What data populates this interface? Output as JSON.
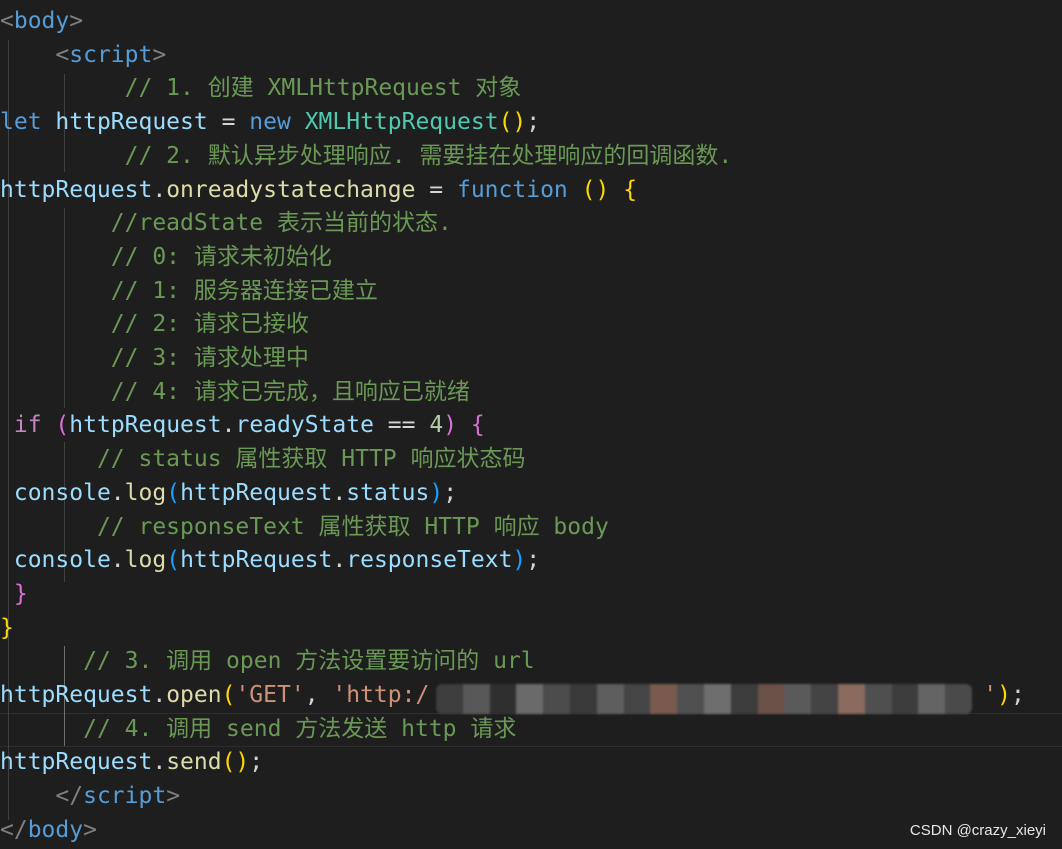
{
  "editor": {
    "theme": "dark",
    "background": "#1e1e1e",
    "lines": [
      [
        [
          "t-punct",
          "<"
        ],
        [
          "t-tag",
          "body"
        ],
        [
          "t-punct",
          ">"
        ]
      ],
      [
        [
          "t-op",
          "    "
        ],
        [
          "t-punct",
          "<"
        ],
        [
          "t-tag",
          "script"
        ],
        [
          "t-punct",
          ">"
        ]
      ],
      [
        [
          "t-op",
          "         "
        ],
        [
          "t-cm",
          "// 1. 创建 XMLHttpRequest 对象"
        ]
      ],
      [
        [
          "t-kw",
          "let"
        ],
        [
          "t-op",
          " "
        ],
        [
          "t-var",
          "httpRequest"
        ],
        [
          "t-op",
          " = "
        ],
        [
          "t-kw",
          "new"
        ],
        [
          "t-op",
          " "
        ],
        [
          "t-cls",
          "XMLHttpRequest"
        ],
        [
          "b1",
          "()"
        ],
        [
          "t-op",
          ";"
        ]
      ],
      [
        [
          "t-op",
          "         "
        ],
        [
          "t-cm",
          "// 2. 默认异步处理响应. 需要挂在处理响应的回调函数."
        ]
      ],
      [
        [
          "t-var",
          "httpRequest"
        ],
        [
          "t-op",
          "."
        ],
        [
          "t-fn",
          "onreadystatechange"
        ],
        [
          "t-op",
          " = "
        ],
        [
          "t-kw",
          "function"
        ],
        [
          "t-op",
          " "
        ],
        [
          "b1",
          "()"
        ],
        [
          "t-op",
          " "
        ],
        [
          "b1",
          "{"
        ]
      ],
      [
        [
          "t-op",
          "        "
        ],
        [
          "t-cm",
          "//readState 表示当前的状态."
        ]
      ],
      [
        [
          "t-op",
          "        "
        ],
        [
          "t-cm",
          "// 0: 请求未初始化"
        ]
      ],
      [
        [
          "t-op",
          "        "
        ],
        [
          "t-cm",
          "// 1: 服务器连接已建立"
        ]
      ],
      [
        [
          "t-op",
          "        "
        ],
        [
          "t-cm",
          "// 2: 请求已接收"
        ]
      ],
      [
        [
          "t-op",
          "        "
        ],
        [
          "t-cm",
          "// 3: 请求处理中"
        ]
      ],
      [
        [
          "t-op",
          "        "
        ],
        [
          "t-cm",
          "// 4: 请求已完成，且响应已就绪"
        ]
      ],
      [
        [
          "t-op",
          " "
        ],
        [
          "t-ctrl",
          "if"
        ],
        [
          "t-op",
          " "
        ],
        [
          "b2",
          "("
        ],
        [
          "t-var",
          "httpRequest"
        ],
        [
          "t-op",
          "."
        ],
        [
          "t-var",
          "readyState"
        ],
        [
          "t-op",
          " == "
        ],
        [
          "t-num",
          "4"
        ],
        [
          "b2",
          ")"
        ],
        [
          "t-op",
          " "
        ],
        [
          "b2",
          "{"
        ]
      ],
      [
        [
          "t-op",
          "       "
        ],
        [
          "t-cm",
          "// status 属性获取 HTTP 响应状态码"
        ]
      ],
      [
        [
          "t-op",
          " "
        ],
        [
          "t-var",
          "console"
        ],
        [
          "t-op",
          "."
        ],
        [
          "t-fn",
          "log"
        ],
        [
          "b3",
          "("
        ],
        [
          "t-var",
          "httpRequest"
        ],
        [
          "t-op",
          "."
        ],
        [
          "t-var",
          "status"
        ],
        [
          "b3",
          ")"
        ],
        [
          "t-op",
          ";"
        ]
      ],
      [
        [
          "t-op",
          "       "
        ],
        [
          "t-cm",
          "// responseText 属性获取 HTTP 响应 body"
        ]
      ],
      [
        [
          "t-op",
          " "
        ],
        [
          "t-var",
          "console"
        ],
        [
          "t-op",
          "."
        ],
        [
          "t-fn",
          "log"
        ],
        [
          "b3",
          "("
        ],
        [
          "t-var",
          "httpRequest"
        ],
        [
          "t-op",
          "."
        ],
        [
          "t-var",
          "responseText"
        ],
        [
          "b3",
          ")"
        ],
        [
          "t-op",
          ";"
        ]
      ],
      [
        [
          "t-op",
          " "
        ],
        [
          "b2",
          "}"
        ]
      ],
      [
        [
          "b1",
          "}"
        ]
      ],
      [
        [
          "t-op",
          "      "
        ],
        [
          "t-cm",
          "// 3. 调用 open 方法设置要访问的 url"
        ]
      ],
      [
        [
          "t-var",
          "httpRequest"
        ],
        [
          "t-op",
          "."
        ],
        [
          "t-fn",
          "open"
        ],
        [
          "b1",
          "("
        ],
        [
          "t-str",
          "'GET'"
        ],
        [
          "t-op",
          ", "
        ],
        [
          "t-str",
          "'http:/"
        ],
        [
          "t-op",
          "                                        "
        ],
        [
          "t-str",
          "'"
        ],
        [
          "b1",
          ")"
        ],
        [
          "t-op",
          ";"
        ]
      ],
      [
        [
          "t-op",
          "      "
        ],
        [
          "t-cm",
          "// 4. 调用 send 方法发送 http 请求"
        ]
      ],
      [
        [
          "t-var",
          "httpRequest"
        ],
        [
          "t-op",
          "."
        ],
        [
          "t-fn",
          "send"
        ],
        [
          "b1",
          "()"
        ],
        [
          "t-op",
          ";"
        ]
      ],
      [
        [
          "t-op",
          "    "
        ],
        [
          "t-punct",
          "</"
        ],
        [
          "t-tag",
          "script"
        ],
        [
          "t-punct",
          ">"
        ]
      ],
      [
        [
          "t-punct",
          "</"
        ],
        [
          "t-tag",
          "body"
        ],
        [
          "t-punct",
          ">"
        ]
      ]
    ]
  },
  "redacted_url_colors": [
    "#3e3e3e",
    "#585858",
    "#2f2f2f",
    "#6a6a6a",
    "#4c4c4c",
    "#3a3a3a",
    "#5e5e5e",
    "#454545",
    "#7a5a4e",
    "#505050",
    "#6e6e6e",
    "#3c3c3c",
    "#6b5148",
    "#5a5a5a",
    "#444444",
    "#8a6a5c",
    "#4f4f4f",
    "#3d3d3d",
    "#646464",
    "#4a4a4a"
  ],
  "watermark": {
    "text": "CSDN @crazy_xieyi"
  }
}
